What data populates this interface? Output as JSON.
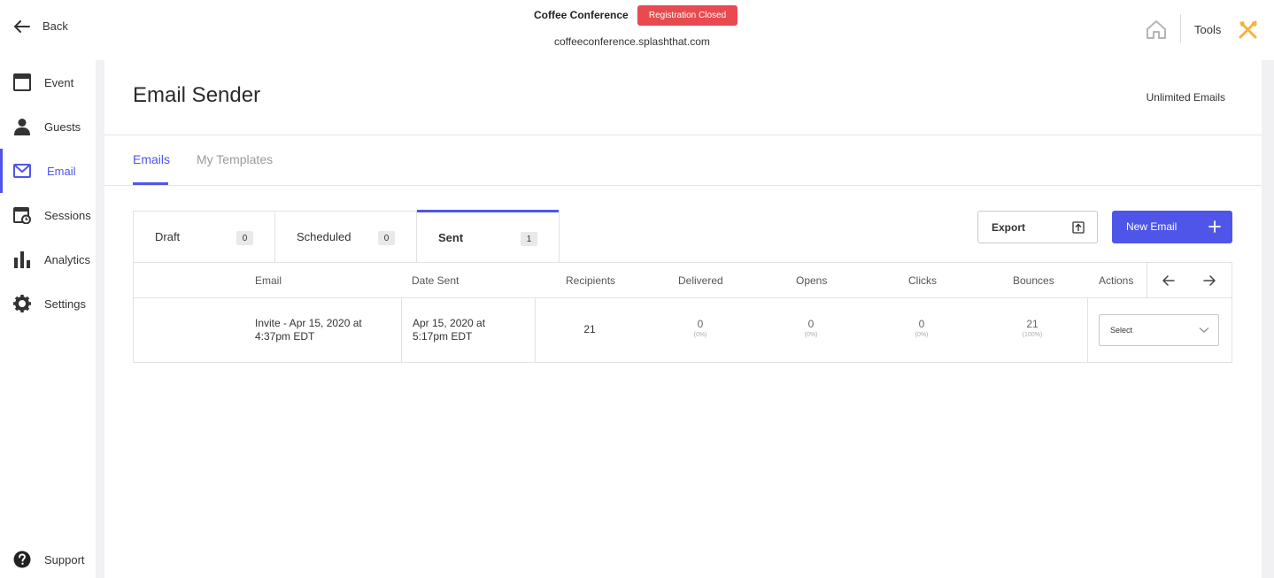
{
  "topbar": {
    "back_label": "Back",
    "event_name": "Coffee Conference",
    "registration_badge": "Registration Closed",
    "event_url": "coffeeconference.splashthat.com",
    "tools_label": "Tools",
    "badge_color": "#e84a4f",
    "tools_icon_color": "#f3b43a"
  },
  "sidebar": {
    "items": [
      {
        "label": "Event",
        "icon": "calendar-icon"
      },
      {
        "label": "Guests",
        "icon": "person-icon"
      },
      {
        "label": "Email",
        "icon": "envelope-icon",
        "active": true
      },
      {
        "label": "Sessions",
        "icon": "sessions-icon"
      },
      {
        "label": "Analytics",
        "icon": "bar-chart-icon"
      },
      {
        "label": "Settings",
        "icon": "gear-icon"
      }
    ],
    "support_label": "Support"
  },
  "main": {
    "title": "Email Sender",
    "unlimited_label": "Unlimited Emails",
    "tabs": [
      {
        "label": "Emails",
        "active": true
      },
      {
        "label": "My Templates",
        "active": false
      }
    ],
    "status_tabs": [
      {
        "label": "Draft",
        "count": "0"
      },
      {
        "label": "Scheduled",
        "count": "0"
      },
      {
        "label": "Sent",
        "count": "1",
        "active": true
      }
    ],
    "export_label": "Export",
    "new_email_label": "New Email",
    "accent_color": "#4f55e9"
  },
  "table": {
    "headers": [
      "Email",
      "Date Sent",
      "Recipients",
      "Delivered",
      "Opens",
      "Clicks",
      "Bounces",
      "Actions"
    ],
    "rows": [
      {
        "email": "Invite - Apr 15, 2020 at 4:37pm EDT",
        "date_sent": "Apr 15, 2020 at 5:17pm EDT",
        "recipients": "21",
        "delivered": "0",
        "delivered_pct": "(0%)",
        "opens": "0",
        "opens_pct": "(0%)",
        "clicks": "0",
        "clicks_pct": "(0%)",
        "bounces": "21",
        "bounces_pct": "(100%)",
        "action_select": "Select"
      }
    ]
  }
}
